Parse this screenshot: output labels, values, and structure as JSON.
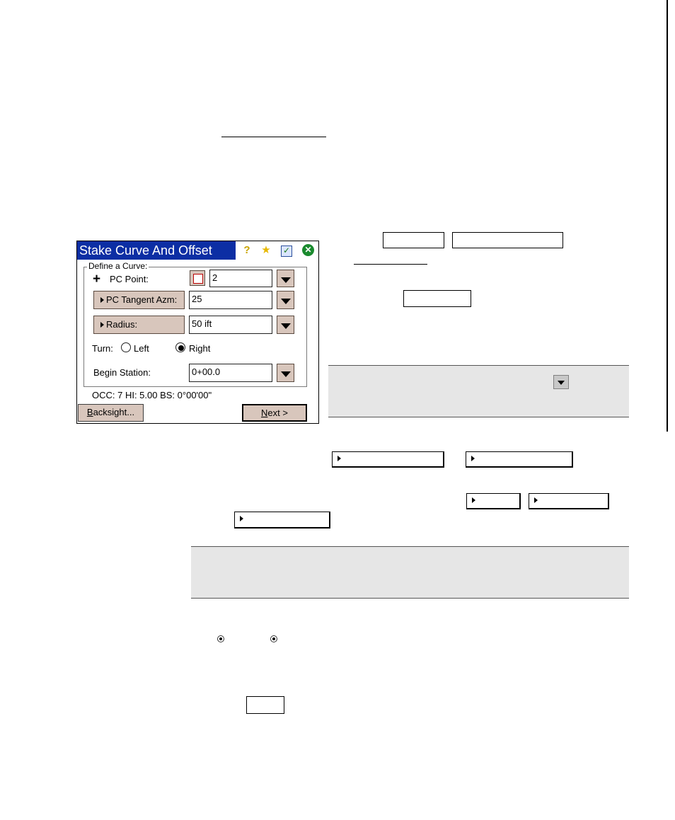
{
  "device": {
    "title": "Stake Curve And Offset",
    "title_icons": [
      "help-icon",
      "favorites-icon",
      "task-icon",
      "close-icon"
    ],
    "group_label": "Define a Curve:",
    "pc_point_label": "PC Point:",
    "pc_point_value": "2",
    "pc_tangent_azm_label": "PC Tangent Azm:",
    "pc_tangent_azm_value": "25",
    "radius_label": "Radius:",
    "radius_value": "50 ift",
    "turn_label": "Turn:",
    "turn_options": [
      {
        "label": "Left",
        "selected": false
      },
      {
        "label": "Right",
        "selected": true
      }
    ],
    "begin_station_label": "Begin Station:",
    "begin_station_value": "0+00.0",
    "status": "OCC: 7  HI: 5.00  BS: 0°00'00\"",
    "backsight_button": {
      "mnemonic": "B",
      "rest": "acksight..."
    },
    "next_button": {
      "mnemonic": "N",
      "rest": "ext >"
    }
  },
  "colors": {
    "titlebar": "#0c2ea4",
    "button_face": "#d8c6bc",
    "note_background": "#e6e6e6"
  }
}
